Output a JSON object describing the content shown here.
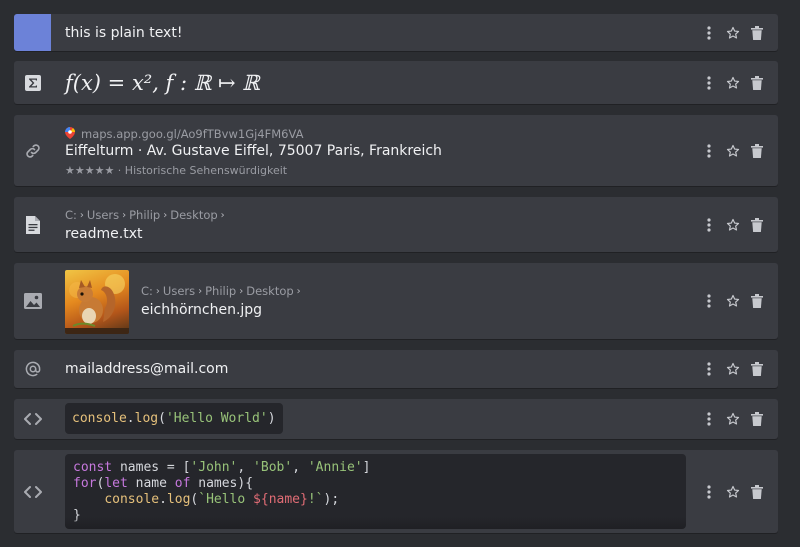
{
  "items": {
    "plain": {
      "text": "this is plain text!",
      "accent": "#6c82d8"
    },
    "math": {
      "formula": "f(x) = x², f : ℝ ↦ ℝ"
    },
    "link": {
      "url": "maps.app.goo.gl/Ao9fTBvw1Gj4FM6VA",
      "title": "Eiffelturm · Av. Gustave Eiffel, 75007 Paris, Frankreich",
      "subtitle": "★★★★★ · Historische Sehenswürdigkeit"
    },
    "file": {
      "path": [
        "C:",
        "Users",
        "Philip",
        "Desktop"
      ],
      "name": "readme.txt"
    },
    "image": {
      "path": [
        "C:",
        "Users",
        "Philip",
        "Desktop"
      ],
      "name": "eichhörnchen.jpg"
    },
    "email": {
      "text": "mailaddress@mail.com"
    },
    "code1": {
      "obj": "console",
      "fn": "log",
      "arg": "'Hello World'"
    },
    "code2": {
      "l1_kw": "const",
      "l1_var": " names = [",
      "l1_s1": "'John'",
      "l1_s2": "'Bob'",
      "l1_s3": "'Annie'",
      "l1_end": "]",
      "l2_kw1": "for",
      "l2_kw2": "let",
      "l2_mid": " name ",
      "l2_kw3": "of",
      "l2_end": " names){",
      "l3_obj": "console",
      "l3_fn": "log",
      "l3_tpl_a": "`Hello ",
      "l3_tpl_expr": "${name}",
      "l3_tpl_b": "!`",
      "l3_end": ");",
      "l4": "}"
    }
  }
}
